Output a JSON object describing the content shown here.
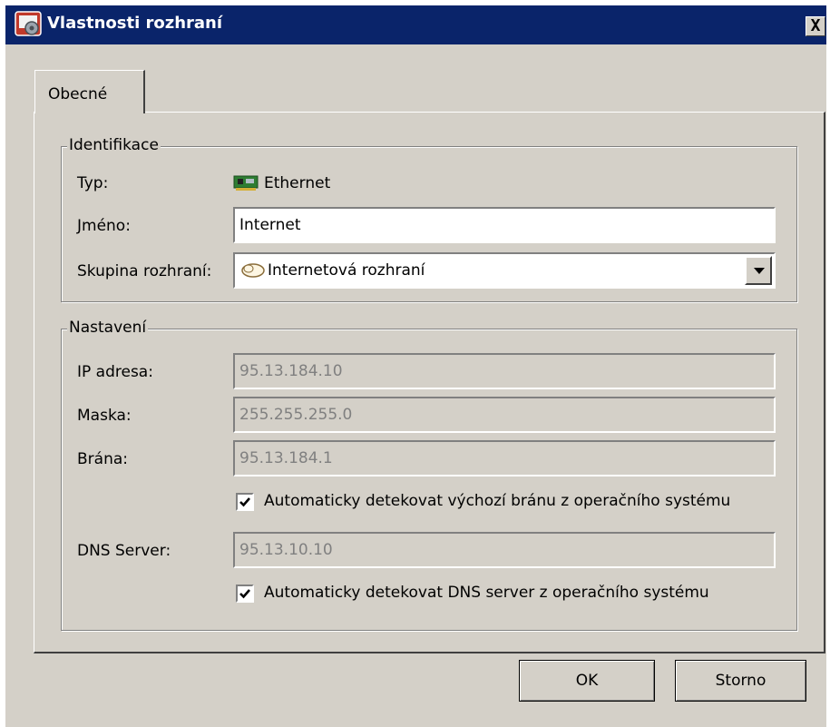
{
  "window": {
    "title": "Vlastnosti rozhraní",
    "close_label": "X",
    "title_icon": "gear-settings-icon"
  },
  "tabs": [
    {
      "label": "Obecné",
      "active": true
    }
  ],
  "identification": {
    "legend": "Identifikace",
    "type_label": "Typ:",
    "type_value": "Ethernet",
    "type_icon": "network-card-icon",
    "name_label": "Jméno:",
    "name_value": "Internet",
    "group_label": "Skupina rozhraní:",
    "group_value": "Internetová rozhraní",
    "group_icon": "cloud-icon"
  },
  "settings": {
    "legend": "Nastavení",
    "ip_label": "IP adresa:",
    "ip_value": "95.13.184.10",
    "mask_label": "Maska:",
    "mask_value": "255.255.255.0",
    "gateway_label": "Brána:",
    "gateway_value": "95.13.184.1",
    "auto_gateway_label": "Automaticky detekovat výchozí bránu z operačního systému",
    "auto_gateway_checked": true,
    "dns_label": "DNS Server:",
    "dns_value": "95.13.10.10",
    "auto_dns_label": "Automaticky detekovat DNS server z operačního systému",
    "auto_dns_checked": true
  },
  "buttons": {
    "ok": "OK",
    "cancel": "Storno"
  },
  "colors": {
    "titlebar": "#0a246a",
    "face": "#d4d0c8"
  }
}
